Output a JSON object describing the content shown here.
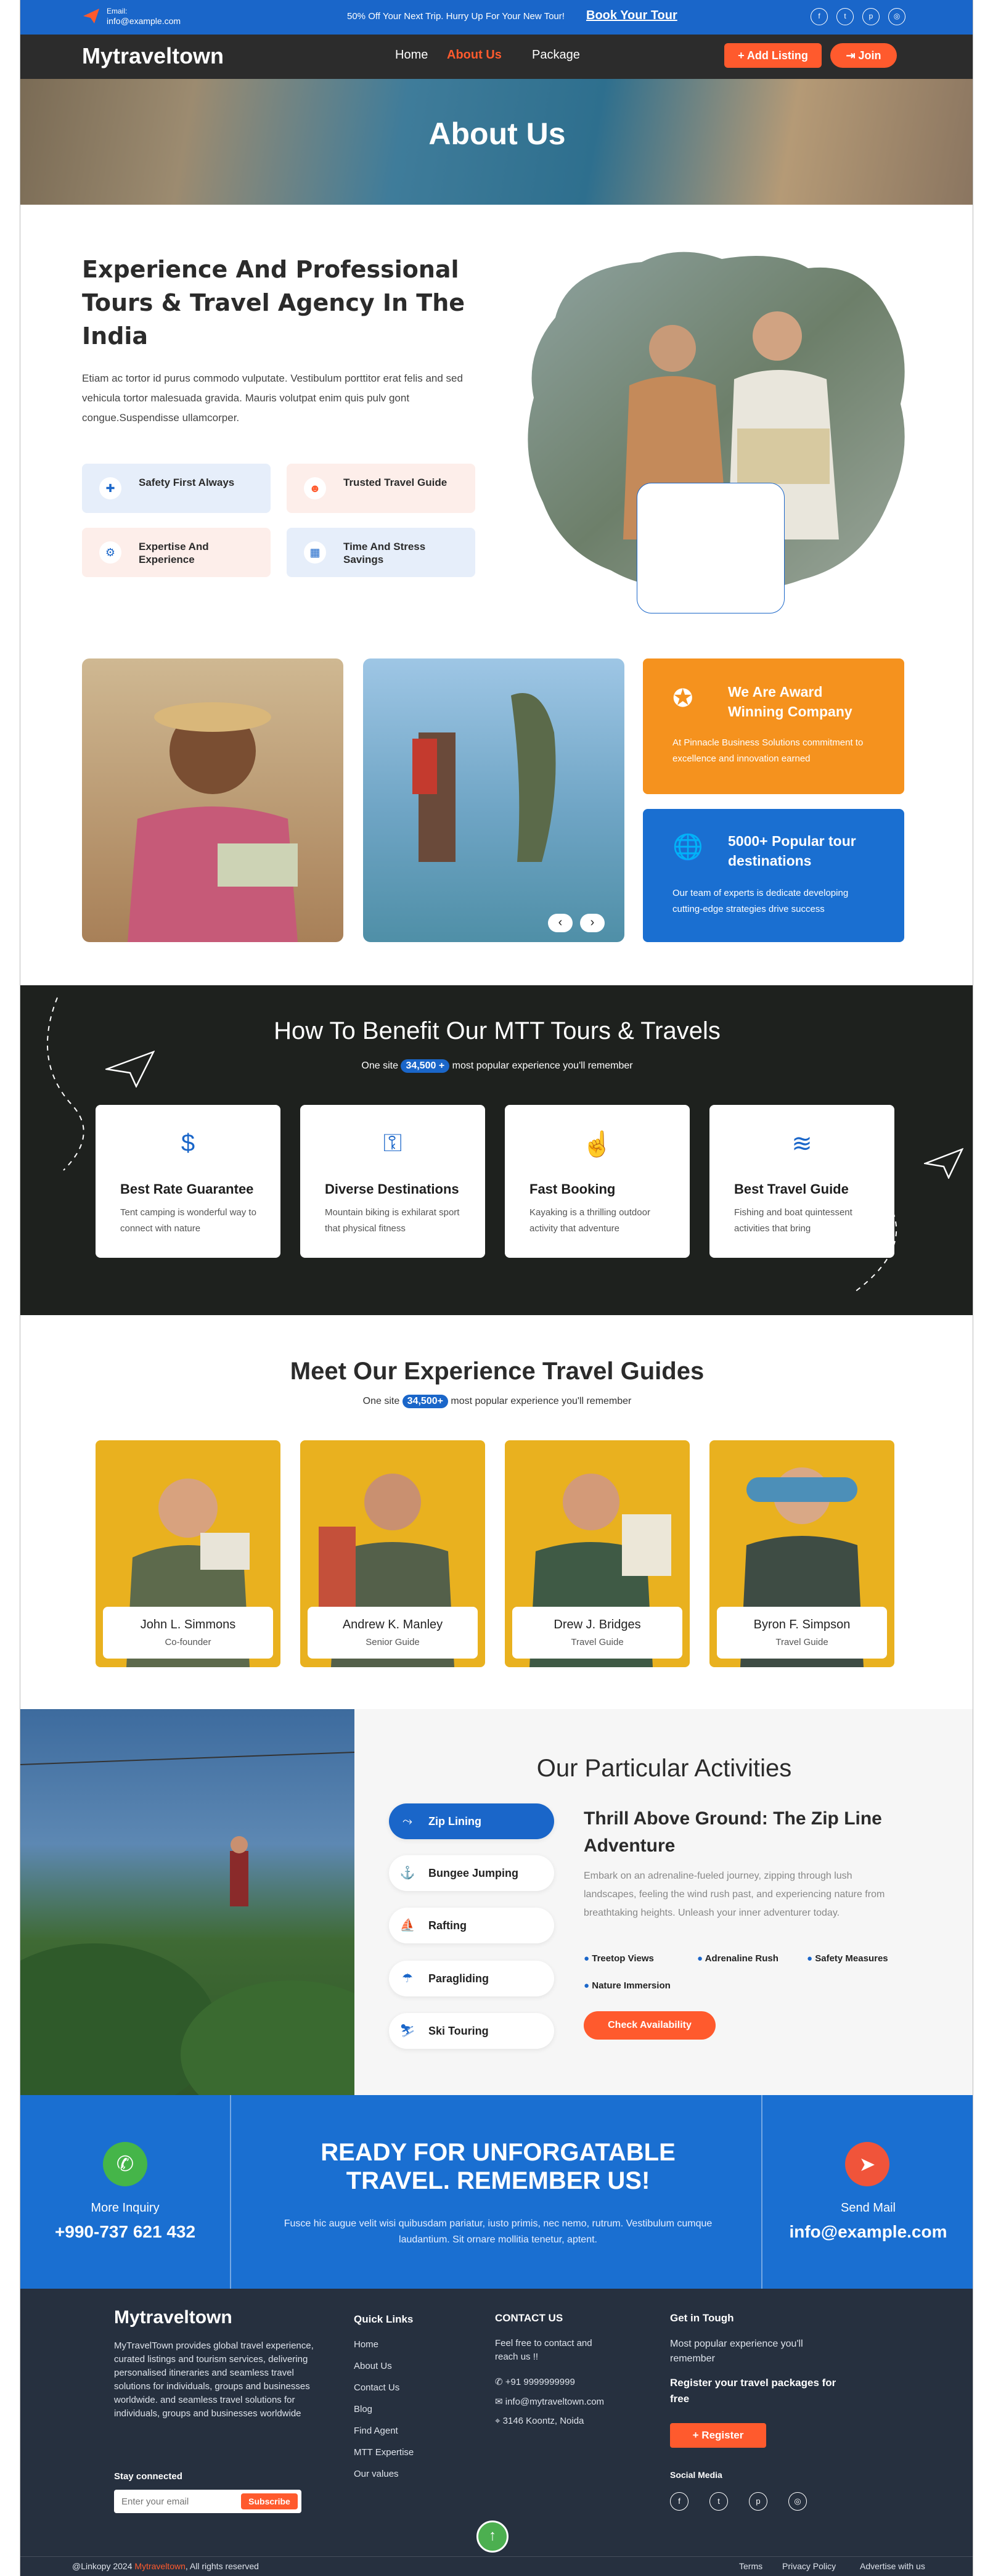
{
  "topbar": {
    "email_label": "Email:",
    "email_value": "info@example.com",
    "promo": "50% Off Your Next Trip. Hurry Up For Your New Tour!",
    "book_link": "Book Your Tour",
    "social_icons": [
      "facebook-icon",
      "twitter-icon",
      "pinterest-icon",
      "instagram-icon"
    ]
  },
  "header": {
    "logo": "Mytraveltown",
    "nav": [
      "Home",
      "About Us",
      "Package"
    ],
    "active": "About Us",
    "add_listing": "+ Add Listing",
    "join": "⇥ Join"
  },
  "hero": {
    "title": "About Us"
  },
  "about": {
    "title": "Experience And Professional Tours & Travel Agency In The India",
    "text": "Etiam ac tortor id purus commodo vulputate. Vestibulum porttitor erat felis and sed vehicula tortor malesuada gravida. Mauris volutpat enim quis pulv gont congue.Suspendisse ullamcorper.",
    "features": [
      {
        "label": "Safety First Always",
        "icon": "medical-kit-icon"
      },
      {
        "label": "Trusted Travel Guide",
        "icon": "guide-icon"
      },
      {
        "label": "Expertise And Experience",
        "icon": "settings-icon"
      },
      {
        "label": "Time And Stress Savings",
        "icon": "building-icon"
      }
    ]
  },
  "gallery": {
    "award_title": "We Are Award Winning Company",
    "award_text": "At Pinnacle Business Solutions commitment to excellence and innovation earned",
    "tours_title": "5000+ Popular tour destinations",
    "tours_text": "Our team of experts is dedicate developing cutting-edge strategies drive success",
    "prev": "‹",
    "next": "›"
  },
  "benefits": {
    "title": "How To Benefit Our MTT Tours & Travels",
    "sub_pre": "One site",
    "sub_pill": "34,500 +",
    "sub_post": "most popular experience you'll remember",
    "cards": [
      {
        "title": "Best Rate Guarantee",
        "text": "Tent camping is wonderful way to connect with nature",
        "icon": "money-hand-icon"
      },
      {
        "title": "Diverse Destinations",
        "text": "Mountain biking is exhilarat sport that physical fitness",
        "icon": "luggage-icon"
      },
      {
        "title": "Fast Booking",
        "text": "Kayaking is a thrilling outdoor activity that adventure",
        "icon": "booking-icon"
      },
      {
        "title": "Best Travel Guide",
        "text": "Fishing and boat quintessent activities that bring",
        "icon": "guide-wave-icon"
      }
    ]
  },
  "guides": {
    "title": "Meet Our Experience Travel Guides",
    "sub_pre": "One site",
    "sub_pill": "34,500+",
    "sub_post": "most popular experience you'll remember",
    "people": [
      {
        "name": "John L. Simmons",
        "role": "Co-founder"
      },
      {
        "name": "Andrew K. Manley",
        "role": "Senior Guide"
      },
      {
        "name": "Drew J. Bridges",
        "role": "Travel Guide"
      },
      {
        "name": "Byron F. Simpson",
        "role": "Travel Guide"
      }
    ]
  },
  "activities": {
    "title": "Our Particular Activities",
    "items": [
      {
        "label": "Zip Lining",
        "icon": "zipline-icon"
      },
      {
        "label": "Bungee Jumping",
        "icon": "bungee-icon"
      },
      {
        "label": "Rafting",
        "icon": "rafting-icon"
      },
      {
        "label": "Paragliding",
        "icon": "paraglider-icon"
      },
      {
        "label": "Ski Touring",
        "icon": "ski-icon"
      }
    ],
    "selected": "Zip Lining",
    "detail_title": "Thrill Above Ground: The Zip Line Adventure",
    "detail_text": "Embark on an adrenaline-fueled journey, zipping through lush landscapes, feeling the wind rush past, and experiencing nature from breathtaking heights. Unleash your inner adventurer today.",
    "tags": [
      "Treetop Views",
      "Adrenaline Rush",
      "Safety Measures",
      "Nature Immersion"
    ],
    "button": "Check Availability"
  },
  "cta": {
    "left_label": "More Inquiry",
    "phone": "+990-737 621 432",
    "title": "READY FOR UNFORGATABLE TRAVEL. REMEMBER US!",
    "text": "Fusce hic augue velit wisi quibusdam pariatur, iusto primis, nec nemo, rutrum. Vestibulum cumque laudantium. Sit ornare mollitia tenetur, aptent.",
    "right_label": "Send Mail",
    "email": "info@example.com"
  },
  "footer": {
    "brand": "Mytraveltown",
    "about": "MyTravelTown provides global travel experience, curated listings and tourism services, delivering personalised itineraries and seamless travel solutions for individuals, groups and businesses worldwide.  and seamless travel solutions for individuals, groups and businesses worldwide",
    "stay": "Stay connected",
    "email_placeholder": "Enter your email",
    "subscribe": "Subscribe",
    "quick_title": "Quick Links",
    "quick_links": [
      "Home",
      "About Us",
      "Contact Us",
      "Blog",
      "Find Agent",
      "MTT Expertise",
      "Our values"
    ],
    "contact_title": "CONTACT US",
    "contact_text": "Feel free to contact and reach us !!",
    "contact_phone": "+91 9999999999",
    "contact_email": "info@mytraveltown.com",
    "contact_address": "3146 Koontz, Noida",
    "touch_title": "Get in Tough",
    "touch_text": "Most popular experience you'll remember",
    "touch_reg": "Register your travel packages for free",
    "register": "+ Register",
    "social_title": "Social Media",
    "copyright_pre": "@Linkopy 2024",
    "copyright_brand": "Mytraveltown",
    "copyright_post": ", All rights reserved",
    "bottom_links": [
      "Terms",
      "Privacy Policy",
      "Advertise with us"
    ]
  },
  "colors": {
    "primary": "#1a66c9",
    "accent": "#ff5a2d",
    "dark": "#1e211e",
    "footer": "#26303f",
    "award": "#f5921e"
  }
}
